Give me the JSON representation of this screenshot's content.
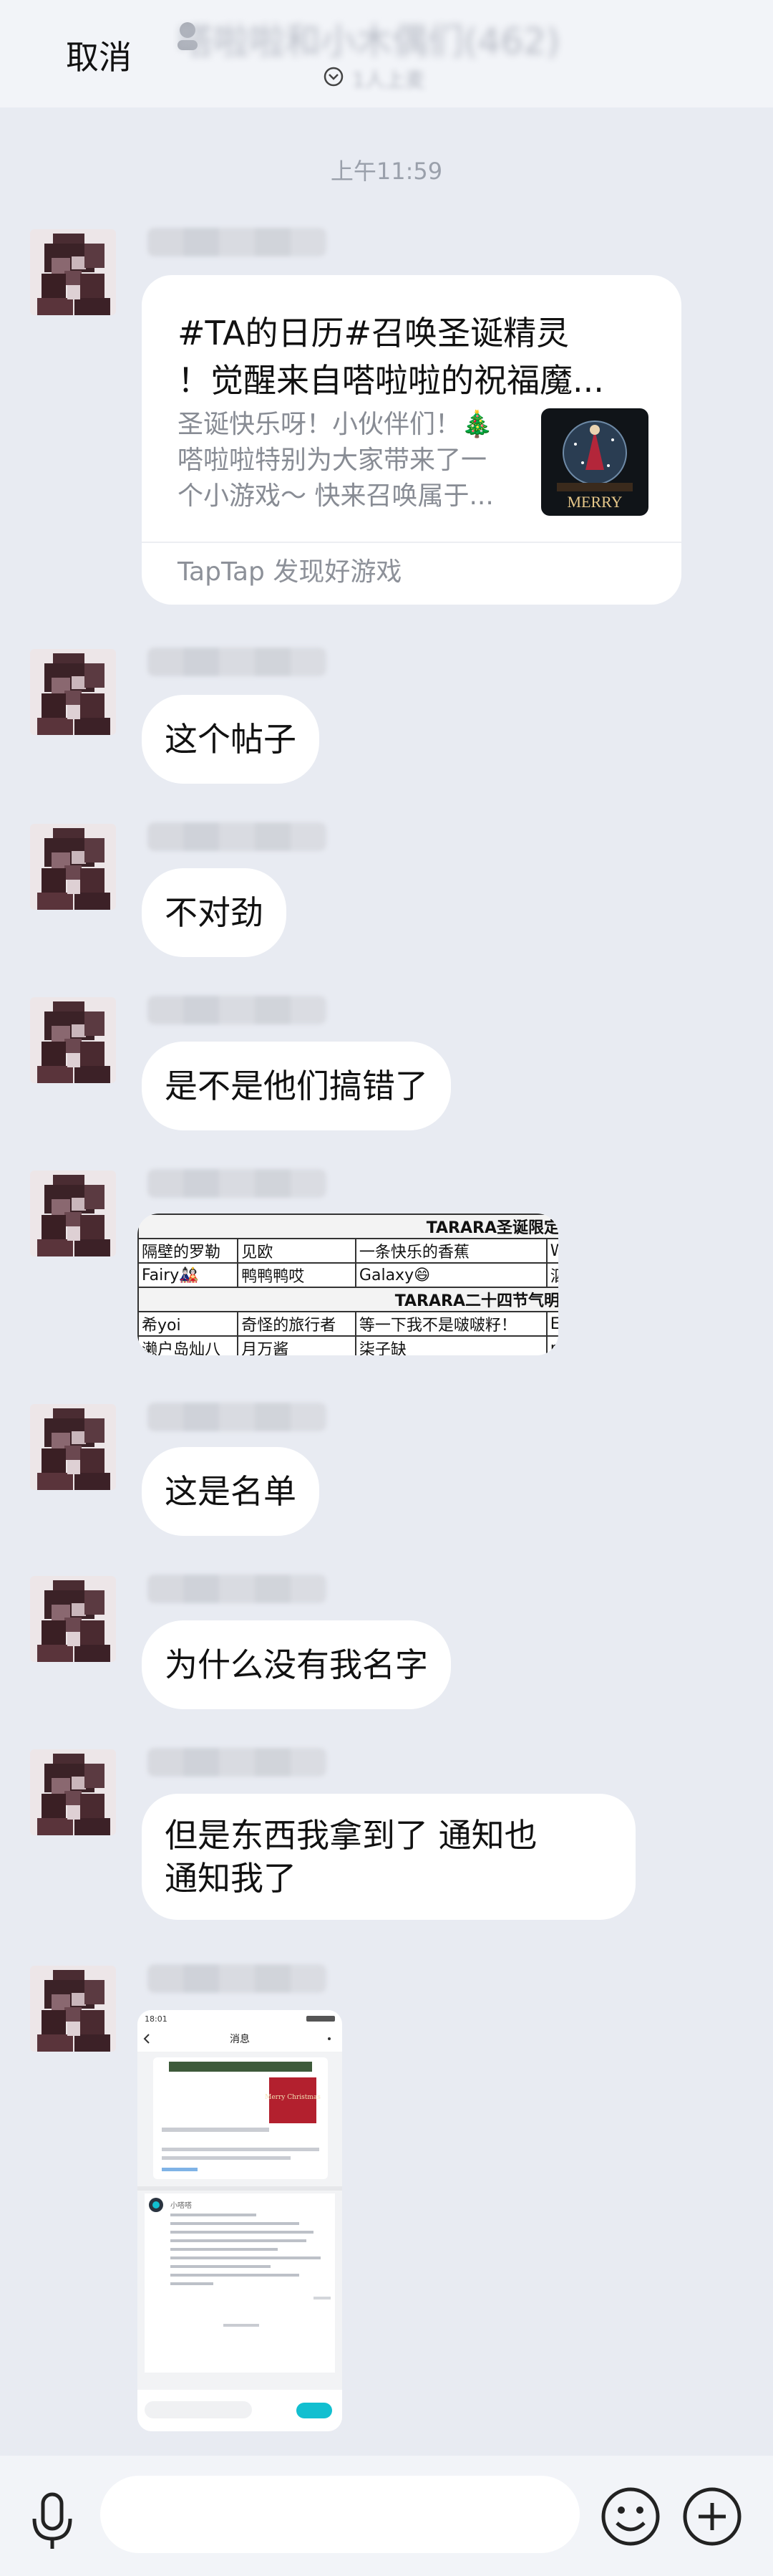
{
  "header": {
    "cancel_label": "取消",
    "group_title": "嗒啦啦和小木偶们(462)",
    "subtitle": "1人上麦"
  },
  "timestamp": "上午11:59",
  "messages": [
    {
      "type": "share_card",
      "title_line1": "#TA的日历#召唤圣诞精灵",
      "title_line2": "！觉醒来自嗒啦啦的祝福魔...",
      "desc_line1": "圣诞快乐呀！小伙伴们！🎄",
      "desc_line2": " 嗒啦啦特别为大家带来了一",
      "desc_line3": "个小游戏～ 快来召唤属于...",
      "thumb_text": "MERRY",
      "source": "TapTap 发现好游戏"
    },
    {
      "type": "text",
      "text": "这个帖子"
    },
    {
      "type": "text",
      "text": "不对劲"
    },
    {
      "type": "text",
      "text": "是不是他们搞错了"
    },
    {
      "type": "image_table",
      "title1": "TARARA圣诞限定挂件",
      "row1": [
        "隔壁的罗勒",
        "见欧",
        "一条快乐的香蕉",
        "W ."
      ],
      "row2": [
        "Fairy🎎",
        "鸭鸭鸭哎",
        "Galaxy😄",
        "泗泗"
      ],
      "title2": "TARARA二十四节气明信片",
      "row3": [
        "希yoi",
        "奇怪的旅行者",
        "等一下我不是啵啵籽！",
        "Erza"
      ],
      "row4": [
        "濑户岛灿八",
        "月万酱",
        "柒子缺",
        "mo"
      ]
    },
    {
      "type": "text",
      "text": "这是名单"
    },
    {
      "type": "text",
      "text": "为什么没有我名字"
    },
    {
      "type": "text",
      "text_line1": "但是东西我拿到了 通知也",
      "text_line2": "通知我了"
    },
    {
      "type": "image_screenshot",
      "status_time": "18:01",
      "header_title": "消息",
      "card_thumb_text": "Merry Christmas",
      "comment_name": "小嗒嗒"
    }
  ],
  "input": {
    "placeholder": ""
  },
  "colors": {
    "bubble": "#ffffff",
    "background": "#e8ebf2",
    "accent": "#12bfd0"
  },
  "icons": [
    "voice-icon",
    "emoji-icon",
    "plus-icon",
    "chevron-down-icon"
  ]
}
